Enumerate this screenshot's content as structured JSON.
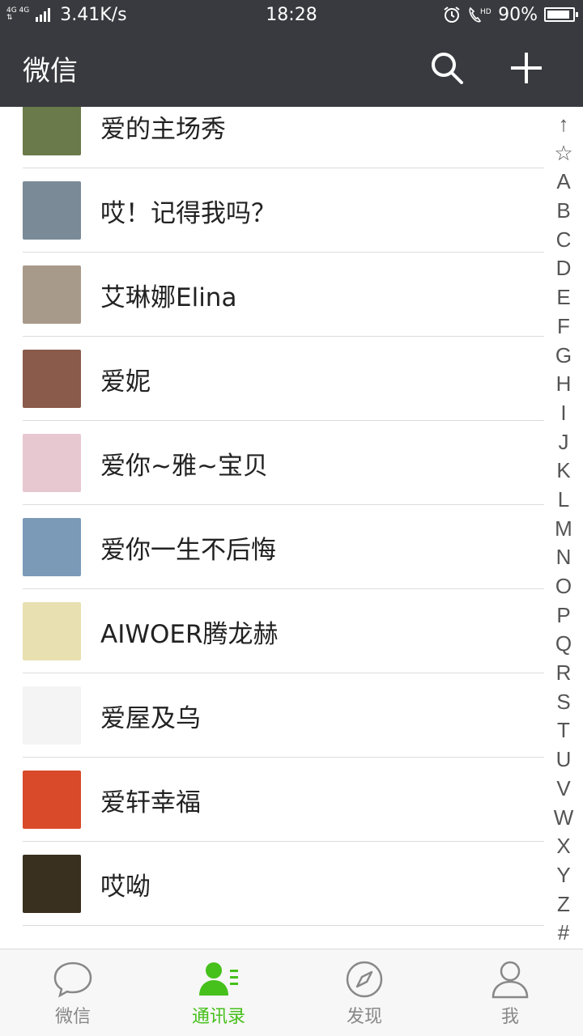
{
  "status_bar": {
    "network_top": "4G 4G",
    "network_bottom": "⇅",
    "speed": "3.41K/s",
    "time": "18:28",
    "battery": "90%",
    "battery_level": 0.9
  },
  "header": {
    "title": "微信",
    "search_icon": "search-icon",
    "add_icon": "plus-icon"
  },
  "contacts": [
    {
      "name": "爱的主场秀",
      "avatar_color": "#6a7a4a"
    },
    {
      "name": "哎！记得我吗？",
      "avatar_color": "#7a8a96"
    },
    {
      "name": "艾琳娜Elina",
      "avatar_color": "#a89a8a"
    },
    {
      "name": "爱妮",
      "avatar_color": "#8a5a4a"
    },
    {
      "name": "爱你~雅~宝贝",
      "avatar_color": "#e8c8d0"
    },
    {
      "name": "爱你一生不后悔",
      "avatar_color": "#7a9ab8"
    },
    {
      "name": "AIWOER腾龙赫",
      "avatar_color": "#e8e0b0"
    },
    {
      "name": "爱屋及乌",
      "avatar_color": "#f4f4f4"
    },
    {
      "name": "爱轩幸福",
      "avatar_color": "#d84a2a"
    },
    {
      "name": "哎呦",
      "avatar_color": "#3a3020"
    }
  ],
  "alphabet_index": [
    "↑",
    "☆",
    "A",
    "B",
    "C",
    "D",
    "E",
    "F",
    "G",
    "H",
    "I",
    "J",
    "K",
    "L",
    "M",
    "N",
    "O",
    "P",
    "Q",
    "R",
    "S",
    "T",
    "U",
    "V",
    "W",
    "X",
    "Y",
    "Z",
    "#"
  ],
  "tabs": [
    {
      "label": "微信",
      "icon": "chat-bubble-icon",
      "active": false
    },
    {
      "label": "通讯录",
      "icon": "contacts-icon",
      "active": true
    },
    {
      "label": "发现",
      "icon": "compass-icon",
      "active": false
    },
    {
      "label": "我",
      "icon": "person-icon",
      "active": false
    }
  ],
  "colors": {
    "header_bg": "#393a3f",
    "accent": "#46c01b",
    "tab_inactive": "#888888"
  }
}
